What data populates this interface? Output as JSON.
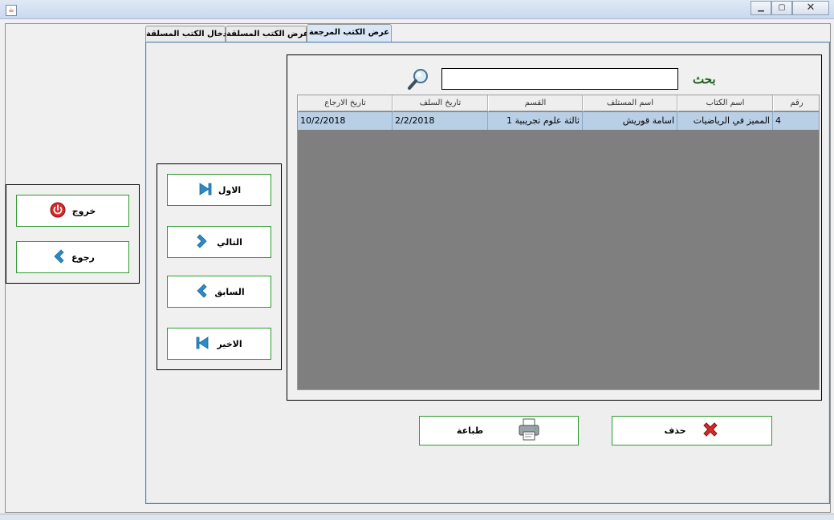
{
  "tabs": [
    {
      "label": "ادخال الكتب المسلقة"
    },
    {
      "label": "عرض الكتب المسلقة"
    },
    {
      "label": "عرض الكتب المرجعة"
    }
  ],
  "search": {
    "label": "بحث",
    "value": ""
  },
  "table": {
    "columns": [
      "رقم",
      "اسم الكتاب",
      "اسم المستلف",
      "القسم",
      "تاريخ السلف",
      "تاريخ الارجاع"
    ],
    "rows": [
      {
        "number": "4",
        "book": "المميز في الرياضيات",
        "borrower": "اسامة قوريش",
        "section": "ثالثة علوم تجريبية 1",
        "borrow_date": "2/2/2018",
        "return_date": "10/2/2018"
      }
    ]
  },
  "nav": {
    "first": "الاول",
    "next": "التالي",
    "prev": "السابق",
    "last": "الاخير"
  },
  "side": {
    "exit": "خروج",
    "back": "رجوع"
  },
  "actions": {
    "print": "طباعة",
    "delete": "حذف"
  },
  "colors": {
    "button_border": "#2f9a2f",
    "selected_row": "#b8cfe5",
    "grid_bg": "#7f7f7f",
    "nav_arrow": "#2a8bc8",
    "exit_icon": "#d42a2a",
    "delete_icon": "#d42a2a"
  },
  "icons": {
    "window": "java-cup-icon",
    "search": "magnifier-icon",
    "first": "skip-first-icon",
    "next": "chevron-right-icon",
    "prev": "chevron-left-icon",
    "last": "skip-last-icon",
    "exit": "power-icon",
    "back": "chevron-left-icon",
    "print": "printer-icon",
    "delete": "red-x-icon"
  }
}
